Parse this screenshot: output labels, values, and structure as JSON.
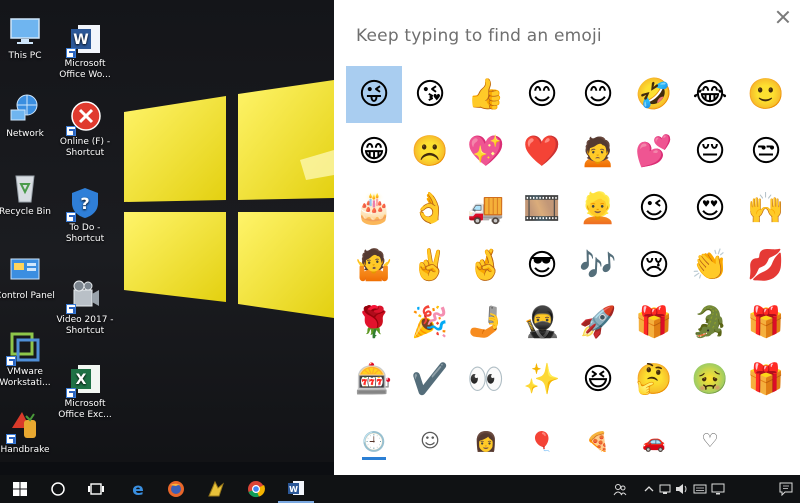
{
  "desktop": {
    "icons": [
      {
        "label": "This PC",
        "icon": "this-pc-icon"
      },
      {
        "label": "Network",
        "icon": "network-icon"
      },
      {
        "label": "Recycle Bin",
        "icon": "recycle-bin-icon"
      },
      {
        "label": "Control Panel",
        "icon": "control-panel-icon"
      },
      {
        "label": "VMware Workstati...",
        "icon": "vmware-icon"
      },
      {
        "label": "Handbrake",
        "icon": "handbrake-icon"
      },
      {
        "label": "Microsoft Office Wo...",
        "icon": "word-icon"
      },
      {
        "label": "Online (F) - Shortcut",
        "icon": "error-icon"
      },
      {
        "label": "To Do - Shortcut",
        "icon": "help-shield-icon"
      },
      {
        "label": "Video 2017 - Shortcut",
        "icon": "video-camera-icon"
      },
      {
        "label": "Microsoft Office Exc...",
        "icon": "excel-icon"
      }
    ],
    "colors": {
      "wallpaper_yellow": "#f2e21c"
    }
  },
  "emoji_panel": {
    "search_prompt": "Keep typing to find an emoji",
    "emojis": [
      "😜",
      "😘",
      "👍",
      "😊",
      "😊",
      "🤣",
      "😂",
      "🙂",
      "😁",
      "☹️",
      "💖",
      "❤️",
      "🙍",
      "💕",
      "😔",
      "😒",
      "🎂",
      "👌",
      "🚚",
      "🎞️",
      "👱",
      "😉",
      "😍",
      "🙌",
      "🤷",
      "✌️",
      "🤞",
      "😎",
      "🎶",
      "😢",
      "👏",
      "💋",
      "🌹",
      "🎉",
      "🤳",
      "🥷",
      "🚀",
      "🎁",
      "🐊",
      "🎁",
      "🎰",
      "✔️",
      "👀",
      "✨",
      "😆",
      "🤔",
      "🤢",
      "🎁"
    ],
    "selected_index": 0,
    "categories": [
      {
        "icon": "recent-clock-icon",
        "glyph": "🕘"
      },
      {
        "icon": "smiley-face-icon",
        "glyph": "☺"
      },
      {
        "icon": "people-icon",
        "glyph": "👩"
      },
      {
        "icon": "balloon-icon",
        "glyph": "🎈"
      },
      {
        "icon": "food-pizza-icon",
        "glyph": "🍕"
      },
      {
        "icon": "car-icon",
        "glyph": "🚗"
      },
      {
        "icon": "heart-icon",
        "glyph": "♡"
      }
    ],
    "active_category": 0,
    "colors": {
      "selected_bg": "#a9cdf0",
      "accent": "#2b7fd4"
    }
  },
  "taskbar": {
    "items": [
      {
        "icon": "start-windows-icon"
      },
      {
        "icon": "search-circle-icon"
      },
      {
        "icon": "task-view-icon"
      },
      {
        "icon": "edge-browser-icon"
      },
      {
        "icon": "firefox-icon"
      },
      {
        "icon": "pinned-app-icon"
      },
      {
        "icon": "chrome-icon"
      },
      {
        "icon": "word-taskbar-icon"
      }
    ],
    "tray": [
      {
        "icon": "people-tray-icon"
      },
      {
        "icon": "chevron-up-icon"
      },
      {
        "icon": "network-tray-icon"
      },
      {
        "icon": "volume-icon"
      },
      {
        "icon": "keyboard-icon"
      },
      {
        "icon": "display-icon"
      },
      {
        "icon": "notification-icon"
      }
    ]
  }
}
